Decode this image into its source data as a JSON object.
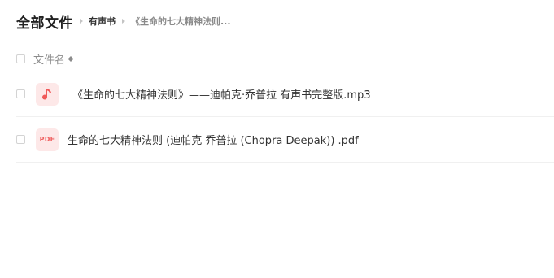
{
  "breadcrumb": {
    "root": "全部文件",
    "middle": "有声书",
    "current": "《生命的七大精神法则..."
  },
  "list_header": {
    "name_column": "文件名"
  },
  "files": [
    {
      "name": "《生命的七大精神法则》——迪帕克·乔普拉 有声书完整版.mp3",
      "type_icon": "music-note-icon",
      "icon_color": "#f05a5a"
    },
    {
      "name": "生命的七大精神法则 (迪帕克 乔普拉 (Chopra Deepak)) .pdf",
      "type_icon": "pdf-icon",
      "icon_label": "PDF",
      "icon_color": "#f06262"
    }
  ]
}
